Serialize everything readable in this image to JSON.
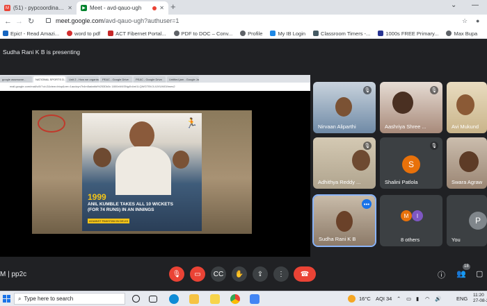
{
  "browser": {
    "tabs": [
      {
        "title": "(51) - pypcoordinator@th",
        "icon": "gmail-icon",
        "active": false
      },
      {
        "title": "Meet - avd-qauo-ugh",
        "icon": "meet-icon",
        "active": true
      }
    ],
    "url_host": "meet.google.com",
    "url_path": "/avd-qauo-ugh?authuser=1",
    "bookmarks": [
      {
        "label": "Epic! - Read Amazi...",
        "color": "#1565c0"
      },
      {
        "label": "word to pdf",
        "color": "#d32f2f"
      },
      {
        "label": "ACT Fibernet Portal...",
        "color": "#c62828"
      },
      {
        "label": "PDF to DOC – Conv...",
        "color": "#5f6368"
      },
      {
        "label": "Profile",
        "color": "#5f6368"
      },
      {
        "label": "My IB Login",
        "color": "#1e88e5"
      },
      {
        "label": "Classroom Timers -...",
        "color": "#455a64"
      },
      {
        "label": "1000s FREE Primary...",
        "color": "#283593"
      },
      {
        "label": "Max Bupa",
        "color": "#5f6368"
      }
    ]
  },
  "meet": {
    "presenter_banner": "Sudha Rani K B is presenting",
    "meeting_code_prefix": "M",
    "meeting_code": "pp2c",
    "participant_count": "18",
    "shared_screen": {
      "tabs": [
        "google assessme...",
        "NATIONAL SPORTS D...",
        "Unit 2 - How we organise...",
        "PE&C - Google Drive",
        "PE&C - Google Drive",
        "Untitled jam - Google Ja..."
      ],
      "url": "mail.google.com/mail/u/0/?ui=2&view=btop&ver=1audzyn7h4m5a#attid%253Dk0c 1800xW4SNg4h4mI1LQWGTBVJLIIJVUMGl/imes2",
      "slide": {
        "year": "1999",
        "caption_line1": "ANIL KUMBLE TAKES ALL 10 WICKETS",
        "caption_line2": "(FOR 74 RUNS) IN AN INNINGS",
        "caption_sub": "AGAINST PAKISTAN IN DELHI"
      }
    },
    "participants": [
      {
        "name": "Nirvaan Aliparthi",
        "muted": true,
        "type": "video",
        "bg": "#6f8aa6"
      },
      {
        "name": "Aashriya Shree ...",
        "muted": true,
        "type": "video",
        "bg": "#a88a7a"
      },
      {
        "name": "Avi Mukund",
        "muted": false,
        "type": "video",
        "bg": "#c9b48a"
      },
      {
        "name": "Adhithya Reddy ...",
        "muted": true,
        "type": "video",
        "bg": "#b0a48e"
      },
      {
        "name": "Shalini Patlola",
        "muted": true,
        "type": "avatar",
        "initial": "S",
        "color": "#e8710a"
      },
      {
        "name": "Swara Agraw",
        "muted": false,
        "type": "video",
        "bg": "#9a8573"
      },
      {
        "name": "Sudha Rani K B",
        "muted": false,
        "type": "video",
        "bg": "#8c7a68",
        "selected": true
      },
      {
        "name": "8 others",
        "muted": false,
        "type": "others",
        "initials": [
          "M",
          "I"
        ],
        "colors": [
          "#e8710a",
          "#7e57c2"
        ]
      },
      {
        "name": "You",
        "muted": false,
        "type": "avatar",
        "initial": "P",
        "color": "#80868b"
      }
    ]
  },
  "taskbar": {
    "search_placeholder": "Type here to search",
    "weather": "16°C",
    "aqi": "AQI 34",
    "language": "ENG",
    "time": "11:20",
    "date": "27-08-2"
  }
}
